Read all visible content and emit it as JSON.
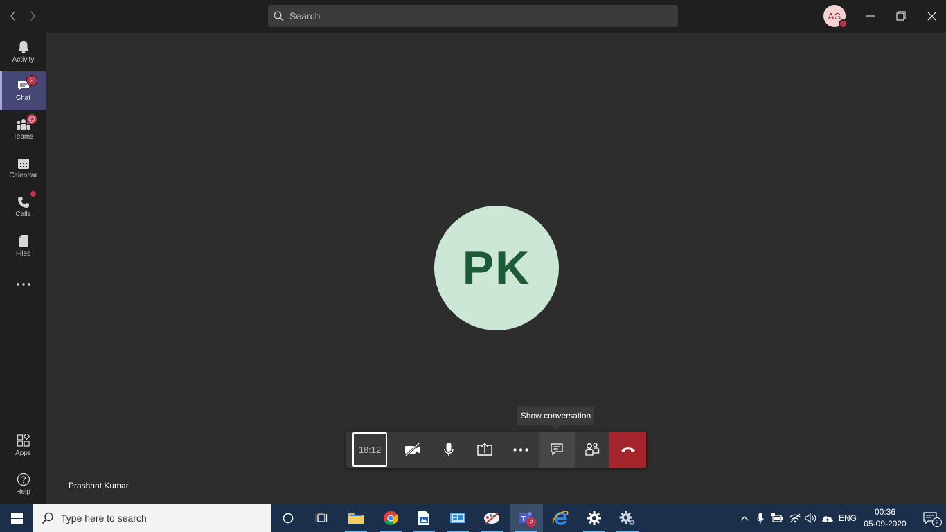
{
  "search": {
    "placeholder": "Search"
  },
  "user": {
    "initials": "AG"
  },
  "rail": {
    "items": [
      {
        "label": "Activity"
      },
      {
        "label": "Chat",
        "badge": "2"
      },
      {
        "label": "Teams",
        "badge": "@"
      },
      {
        "label": "Calendar"
      },
      {
        "label": "Calls"
      },
      {
        "label": "Files"
      }
    ],
    "apps_label": "Apps",
    "help_label": "Help"
  },
  "call": {
    "participant_initials": "PK",
    "participant_name": "Prashant Kumar",
    "duration": "18:12",
    "tooltip": "Show conversation"
  },
  "taskbar": {
    "search_placeholder": "Type here to search",
    "teams_badge": "2",
    "language": "ENG",
    "time": "00:36",
    "date": "05-09-2020",
    "notification_count": "2"
  },
  "colors": {
    "accent": "#464775",
    "hangup": "#a4262c",
    "presence_busy": "#c4314b",
    "avatar_bg": "#cde7d6",
    "avatar_text": "#1d5b38"
  }
}
